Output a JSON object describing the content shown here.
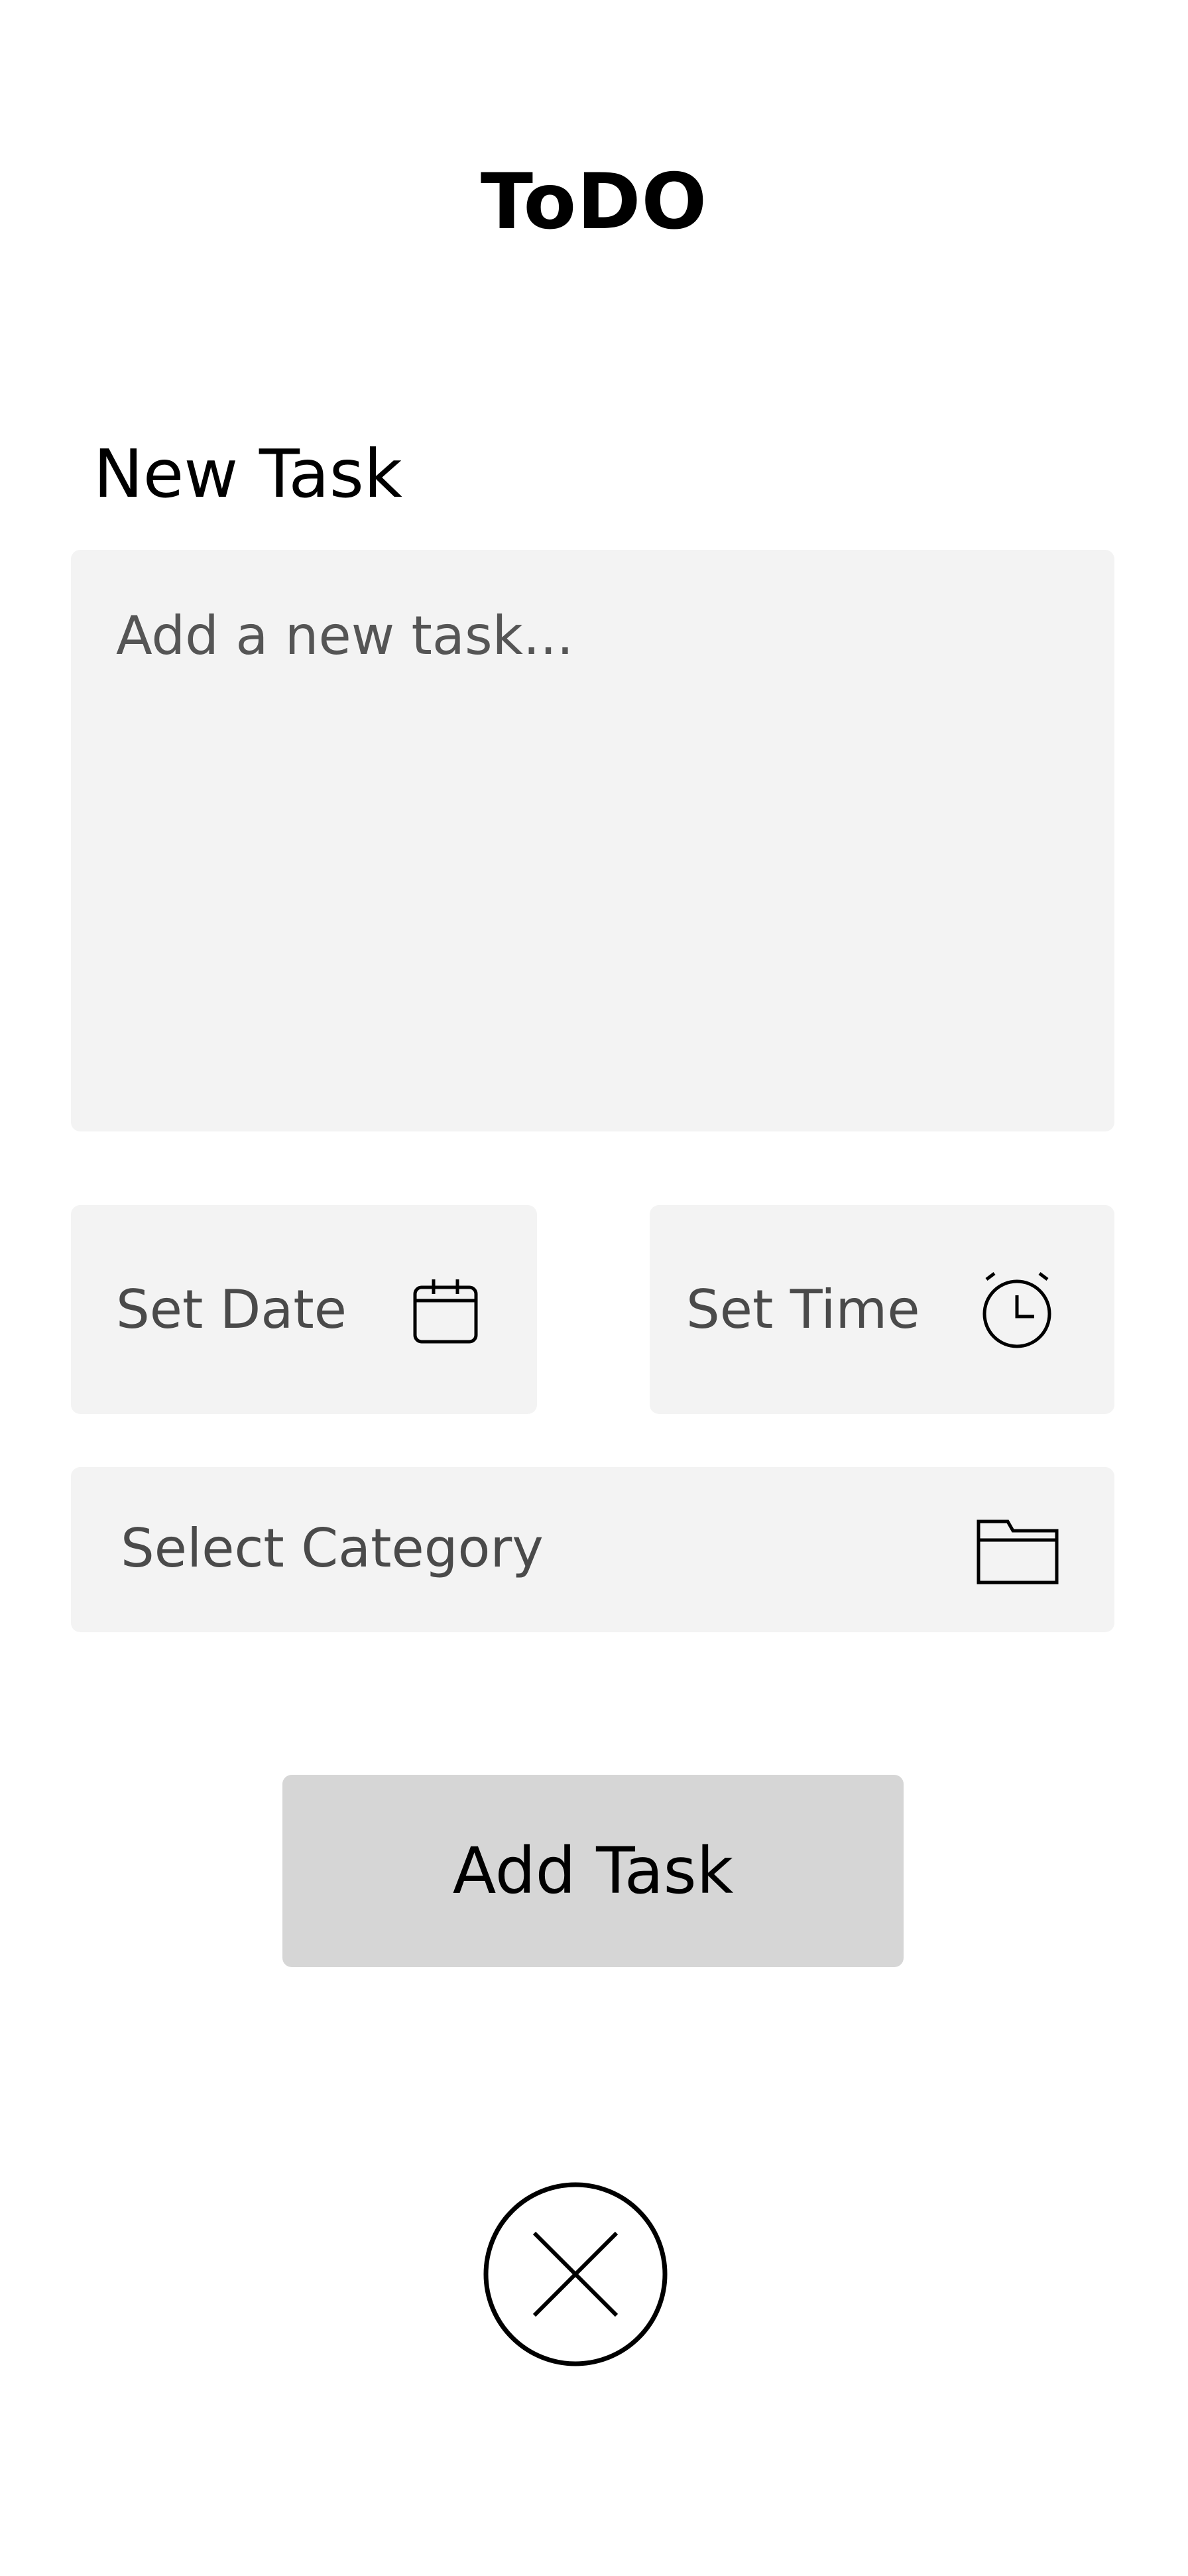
{
  "header": {
    "title": "ToDO"
  },
  "form": {
    "section_label": "New Task",
    "task_placeholder": "Add a new task...",
    "date_label": "Set Date",
    "time_label": "Set Time",
    "category_label": "Select Category",
    "submit_label": "Add Task"
  },
  "icons": {
    "date": "calendar-icon",
    "time": "alarm-clock-icon",
    "category": "folder-icon",
    "close": "close-icon"
  },
  "colors": {
    "field_background": "#f3f3f3",
    "button_background": "#d6d6d6",
    "placeholder_text": "#555555"
  }
}
